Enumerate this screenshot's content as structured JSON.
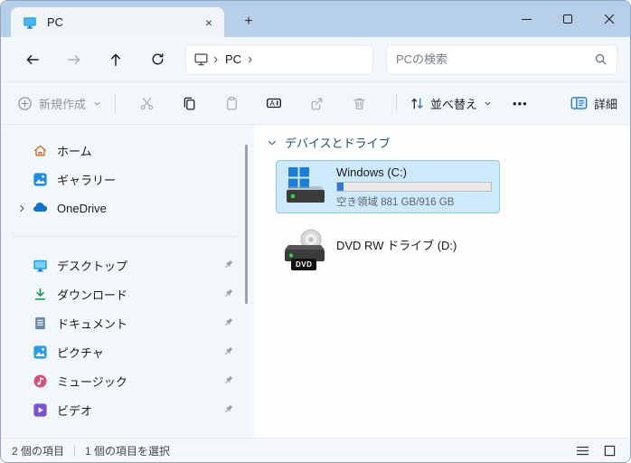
{
  "titlebar": {
    "tab": {
      "title": "PC"
    },
    "tab_close_glyph": "×",
    "new_tab_glyph": "+"
  },
  "navbar": {
    "breadcrumb": {
      "root_label": "PC"
    },
    "search_placeholder": "PCの検索"
  },
  "toolbar": {
    "new_label": "新規作成",
    "sort_label": "並べ替え",
    "more_glyph": "•••",
    "details_label": "詳細"
  },
  "sidebar": {
    "items": [
      {
        "id": "home",
        "label": "ホーム",
        "pinned": false
      },
      {
        "id": "gallery",
        "label": "ギャラリー",
        "pinned": false
      },
      {
        "id": "onedrive",
        "label": "OneDrive",
        "pinned": false,
        "expandable": true
      },
      {
        "id": "desktop",
        "label": "デスクトップ",
        "pinned": true
      },
      {
        "id": "downloads",
        "label": "ダウンロード",
        "pinned": true
      },
      {
        "id": "documents",
        "label": "ドキュメント",
        "pinned": true
      },
      {
        "id": "pictures",
        "label": "ピクチャ",
        "pinned": true
      },
      {
        "id": "music",
        "label": "ミュージック",
        "pinned": true
      },
      {
        "id": "videos",
        "label": "ビデオ",
        "pinned": true
      }
    ]
  },
  "content": {
    "group_header": "デバイスとドライブ",
    "drives": [
      {
        "name": "Windows (C:)",
        "free_space_text": "空き領域 881 GB/916 GB",
        "used_percent": 4,
        "selected": true
      },
      {
        "name": "DVD RW ドライブ (D:)",
        "badge": "DVD",
        "selected": false
      }
    ]
  },
  "statusbar": {
    "item_count": "2 個の項目",
    "selection_info": "1 個の項目を選択"
  },
  "colors": {
    "titlebar": "#b8cfe9",
    "chrome": "#f2f7fb",
    "selection_bg": "#cde9fc",
    "selection_border": "#95c7ec",
    "usage_fill": "#3579c8",
    "accent": "#1d6fc4"
  }
}
